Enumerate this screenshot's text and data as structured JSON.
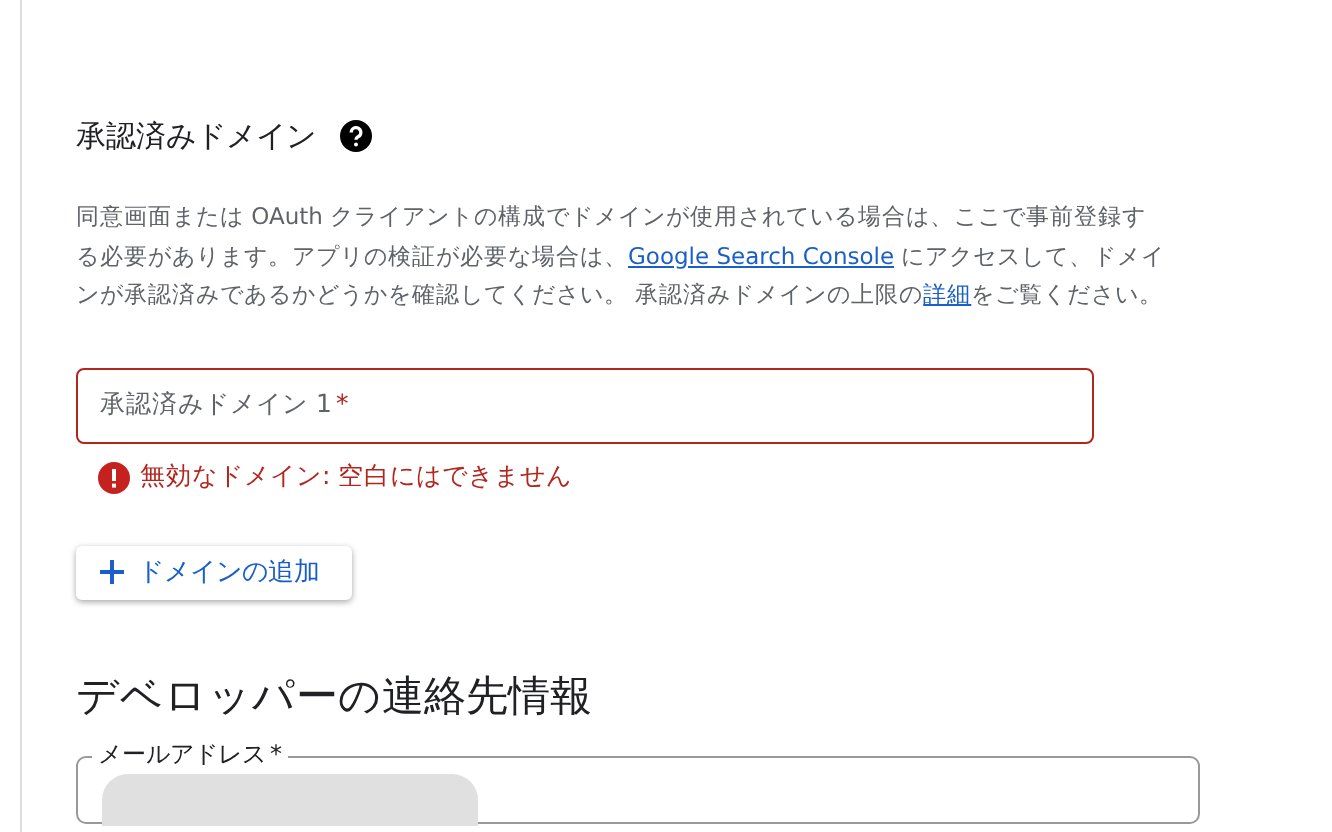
{
  "authorized_domains": {
    "title": "承認済みドメイン",
    "description": "同意画面または OAuth クライアントの構成でドメインが使用されている場合は、ここで事前登録する必要があります。アプリの検証が必要な場合は、",
    "link_1": "Google Search Console",
    "description_2": " にアクセスして、ドメインが承認済みであるかどうかを確認してください。 承認済みドメインの上限の",
    "link_2": "詳細",
    "description_3": "をご覧ください。",
    "fields": [
      {
        "label": "承認済みドメイン 1",
        "required_mark": "*",
        "error": true,
        "error_text": "無効なドメイン: 空白にはできません"
      }
    ],
    "add_button": "ドメインの追加"
  },
  "developer_contact": {
    "title": "デベロッパーの連絡先情報",
    "email_field": {
      "label": "メールアドレス",
      "required_mark": "*"
    }
  }
}
